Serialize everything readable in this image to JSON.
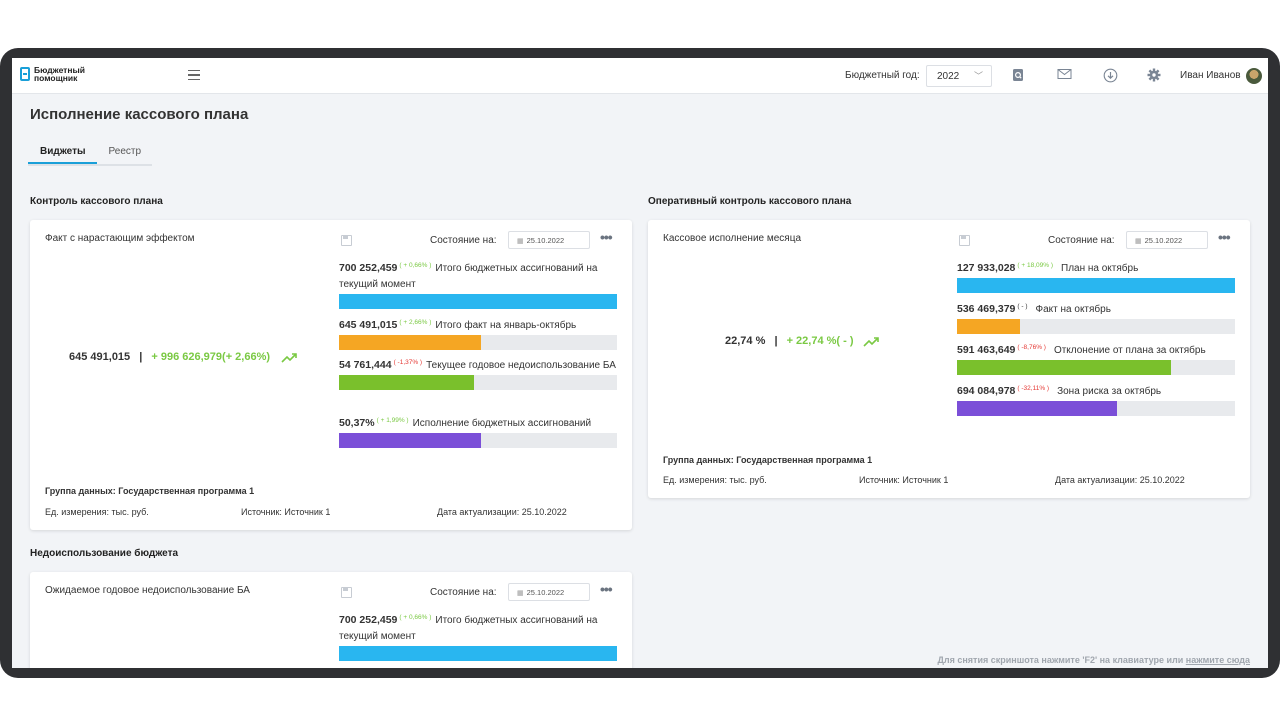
{
  "app": {
    "logo_line1": "Бюджетный",
    "logo_line2": "помощник"
  },
  "topbar": {
    "year_label": "Бюджетный год:",
    "year_value": "2022",
    "user_name": "Иван Иванов"
  },
  "page": {
    "title": "Исполнение кассового плана"
  },
  "tabs": [
    {
      "label": "Виджеты",
      "active": true
    },
    {
      "label": "Реестр",
      "active": false
    }
  ],
  "state_label": "Состояние на:",
  "sections": {
    "control": "Контроль кассового плана",
    "operative": "Оперативный контроль кассового плана",
    "underuse": "Недоиспользование бюджета"
  },
  "card1": {
    "title": "Факт с нарастающим эффектом",
    "date": "25.10.2022",
    "big_value": "645 491,015",
    "big_sep": "|",
    "big_change": "+ 996 626,979(+ 2,66%)",
    "metrics": [
      {
        "value": "700 252,459",
        "change": "( + 0,66% )",
        "label": "Итого бюджетных ассигнований на текущий момент",
        "fill": 1.0,
        "color": "#29b6f0",
        "change_type": "pos"
      },
      {
        "value": "645 491,015",
        "change": "( + 2,66% )",
        "label": "Итого факт на январь-октябрь",
        "fill": 0.51,
        "color": "#f5a623",
        "change_type": "pos"
      },
      {
        "value": "54 761,444",
        "change": "( -1,37% )",
        "label": "Текущее годовое недоиспользование БА",
        "fill": 0.485,
        "color": "#7ac02c",
        "change_type": "neg"
      },
      {
        "value": "50,37%",
        "change": "( + 1,99% )",
        "label": "Исполнение бюджетных ассигнований",
        "fill": 0.51,
        "color": "#7b4fd8",
        "change_type": "pos"
      }
    ],
    "group": "Группа данных: Государственная программа 1",
    "unit": "Ед. измерения: тыс. руб.",
    "source": "Источник: Источник 1",
    "updated": "Дата актуализации: 25.10.2022"
  },
  "card2": {
    "title": "Кассовое исполнение месяца",
    "date": "25.10.2022",
    "big_value": "22,74 %",
    "big_sep": "|",
    "big_change": "+ 22,74 %( - )",
    "metrics": [
      {
        "value": "127 933,028",
        "change": "( + 18,09% )",
        "label": "План на октябрь",
        "fill": 1.0,
        "color": "#29b6f0",
        "change_type": "pos"
      },
      {
        "value": "536 469,379",
        "change": "( - )",
        "label": "Факт на октябрь",
        "fill": 0.225,
        "color": "#f5a623",
        "change_type": "none"
      },
      {
        "value": "591 463,649",
        "change": "( -8,76% )",
        "label": "Отклонение от плана за октябрь",
        "fill": 0.77,
        "color": "#7ac02c",
        "change_type": "neg"
      },
      {
        "value": "694 084,978",
        "change": "( -32,11% )",
        "label": "Зона риска за октябрь",
        "fill": 0.575,
        "color": "#7b4fd8",
        "change_type": "neg"
      }
    ],
    "group": "Группа данных: Государственная программа 1",
    "unit": "Ед. измерения: тыс. руб.",
    "source": "Источник: Источник 1",
    "updated": "Дата актуализации: 25.10.2022"
  },
  "card3": {
    "title": "Ожидаемое годовое недоиспользование БА",
    "date": "25.10.2022",
    "metrics": [
      {
        "value": "700 252,459",
        "change": "( + 0,66% )",
        "label": "Итого бюджетных ассигнований на текущий момент",
        "fill": 1.0,
        "color": "#29b6f0",
        "change_type": "pos"
      }
    ]
  },
  "hint": {
    "text": "Для снятия скриншота нажмите 'F2' на клавиатуре или ",
    "link": "нажмите сюда"
  }
}
